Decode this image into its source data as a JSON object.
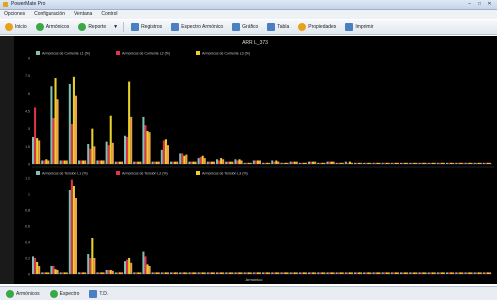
{
  "window": {
    "title": "PowerMate Pro"
  },
  "menu": [
    "Opciones",
    "Configuración",
    "Ventana",
    "Control"
  ],
  "toolbar": {
    "items": [
      {
        "label": "Inicio",
        "icon": "home-icon",
        "color": "#e8a21a"
      },
      {
        "label": "Armónicos",
        "icon": "harmonics-icon",
        "color": "#3aa845"
      },
      {
        "label": "Reporte",
        "icon": "report-icon",
        "color": "#3aa845"
      },
      {
        "label": "Registros",
        "icon": "records-icon",
        "color": "#4a7fc1"
      },
      {
        "label": "Espectro Armónico",
        "icon": "spectrum-icon",
        "color": "#4a7fc1"
      },
      {
        "label": "Gráfico",
        "icon": "chart-icon",
        "color": "#4a7fc1"
      },
      {
        "label": "Tabla",
        "icon": "table-icon",
        "color": "#4a7fc1"
      },
      {
        "label": "Propiedades",
        "icon": "properties-icon",
        "color": "#e8a21a"
      },
      {
        "label": "Imprimir",
        "icon": "printer-icon",
        "color": "#4a7fc1"
      }
    ]
  },
  "status": {
    "items": [
      {
        "label": "Armónicos",
        "color": "#3aa845"
      },
      {
        "label": "Espectro",
        "color": "#3aa845"
      },
      {
        "label": "T.D.",
        "color": "#4a7fc1"
      }
    ]
  },
  "colors": {
    "teal": "#7fbfb5",
    "red": "#e0324a",
    "yellow": "#e8d22a",
    "orange": "#f0a14a",
    "plot_bg": "#000000"
  },
  "chart_data": [
    {
      "type": "bar",
      "title": "ARR  L_373",
      "subtitle": "",
      "ylim": [
        0,
        9
      ],
      "legend_position": "top-left",
      "series": [
        {
          "name": "Armónicos de Corriente L1 (%)",
          "color": "#7fbfb5",
          "values": [
            2.3,
            0.3,
            6.6,
            0.3,
            6.8,
            0.3,
            1.7,
            0.3,
            1.9,
            0.2,
            2.4,
            0.2,
            4.0,
            0.2,
            1.2,
            0.2,
            0.9,
            0.2,
            0.5,
            0.2,
            0.4,
            0.2,
            0.4,
            0.1,
            0.3,
            0.1,
            0.3,
            0.1,
            0.2,
            0.1,
            0.2,
            0.1,
            0.2,
            0.1,
            0.2,
            0.1,
            0.1,
            0.1,
            0.1,
            0.1,
            0.1,
            0.1,
            0.1,
            0.1,
            0.1,
            0.1,
            0.1,
            0.1,
            0.1,
            0.1
          ]
        },
        {
          "name": "Armónicos de Corriente L2 (%)",
          "color": "#e0324a",
          "values": [
            4.8,
            0.3,
            3.9,
            0.3,
            3.4,
            0.3,
            1.3,
            0.3,
            1.6,
            0.2,
            2.3,
            0.2,
            3.3,
            0.2,
            2.0,
            0.2,
            0.9,
            0.2,
            0.6,
            0.2,
            0.3,
            0.2,
            0.3,
            0.1,
            0.3,
            0.1,
            0.2,
            0.1,
            0.2,
            0.1,
            0.2,
            0.1,
            0.2,
            0.1,
            0.1,
            0.1,
            0.1,
            0.1,
            0.1,
            0.1,
            0.1,
            0.1,
            0.1,
            0.1,
            0.1,
            0.1,
            0.1,
            0.1,
            0.1,
            0.1
          ]
        },
        {
          "name": "Armónicos de Corriente L3 (%)",
          "color": "#e8d22a",
          "values": [
            2.2,
            0.4,
            7.3,
            0.3,
            7.4,
            0.3,
            3.0,
            0.3,
            4.1,
            0.2,
            7.0,
            0.2,
            2.8,
            0.2,
            2.1,
            0.2,
            0.7,
            0.2,
            0.7,
            0.2,
            0.5,
            0.2,
            0.4,
            0.1,
            0.3,
            0.1,
            0.3,
            0.1,
            0.2,
            0.1,
            0.2,
            0.1,
            0.2,
            0.1,
            0.2,
            0.1,
            0.1,
            0.1,
            0.1,
            0.1,
            0.1,
            0.1,
            0.1,
            0.1,
            0.1,
            0.1,
            0.1,
            0.1,
            0.1,
            0.1
          ]
        },
        {
          "name": "",
          "color": "#f0a14a",
          "values": [
            2.0,
            0.3,
            5.5,
            0.3,
            5.8,
            0.3,
            1.5,
            0.3,
            1.8,
            0.2,
            4.0,
            0.2,
            2.7,
            0.2,
            1.6,
            0.2,
            0.8,
            0.2,
            0.5,
            0.2,
            0.4,
            0.2,
            0.3,
            0.1,
            0.3,
            0.1,
            0.2,
            0.1,
            0.2,
            0.1,
            0.2,
            0.1,
            0.2,
            0.1,
            0.1,
            0.1,
            0.1,
            0.1,
            0.1,
            0.1,
            0.1,
            0.1,
            0.1,
            0.1,
            0.1,
            0.1,
            0.1,
            0.1,
            0.1,
            0.1
          ]
        }
      ]
    },
    {
      "type": "bar",
      "ylim": [
        0,
        1.2
      ],
      "legend_position": "top-left",
      "xlabel": "Armónico",
      "series": [
        {
          "name": "Armónicos de Tensión L1 (%)",
          "color": "#7fbfb5",
          "values": [
            0.22,
            0.02,
            0.1,
            0.02,
            1.05,
            0.02,
            0.25,
            0.02,
            0.05,
            0.02,
            0.16,
            0.02,
            0.28,
            0.02,
            0.02,
            0.02,
            0.02,
            0.02,
            0.02,
            0.02,
            0.02,
            0.02,
            0.02,
            0.02,
            0.02,
            0.02,
            0.02,
            0.02,
            0.02,
            0.02,
            0.02,
            0.02,
            0.02,
            0.02,
            0.02,
            0.02,
            0.02,
            0.02,
            0.02,
            0.02,
            0.02,
            0.02,
            0.02,
            0.02,
            0.02,
            0.02,
            0.02,
            0.02,
            0.02,
            0.02
          ]
        },
        {
          "name": "Armónicos de Tensión L2 (%)",
          "color": "#e0324a",
          "values": [
            0.2,
            0.02,
            0.1,
            0.02,
            1.18,
            0.02,
            0.2,
            0.02,
            0.05,
            0.02,
            0.18,
            0.02,
            0.22,
            0.02,
            0.02,
            0.02,
            0.02,
            0.02,
            0.02,
            0.02,
            0.02,
            0.02,
            0.02,
            0.02,
            0.02,
            0.02,
            0.02,
            0.02,
            0.02,
            0.02,
            0.02,
            0.02,
            0.02,
            0.02,
            0.02,
            0.02,
            0.02,
            0.02,
            0.02,
            0.02,
            0.02,
            0.02,
            0.02,
            0.02,
            0.02,
            0.02,
            0.02,
            0.02,
            0.02,
            0.02
          ]
        },
        {
          "name": "Armónicos de Tensión L3 (%)",
          "color": "#e8d22a",
          "values": [
            0.15,
            0.02,
            0.06,
            0.02,
            1.1,
            0.02,
            0.45,
            0.02,
            0.05,
            0.02,
            0.2,
            0.02,
            0.12,
            0.02,
            0.02,
            0.02,
            0.02,
            0.02,
            0.02,
            0.02,
            0.02,
            0.02,
            0.02,
            0.02,
            0.02,
            0.02,
            0.02,
            0.02,
            0.02,
            0.02,
            0.02,
            0.02,
            0.02,
            0.02,
            0.02,
            0.02,
            0.02,
            0.02,
            0.02,
            0.02,
            0.02,
            0.02,
            0.02,
            0.02,
            0.02,
            0.02,
            0.02,
            0.02,
            0.02,
            0.02
          ]
        },
        {
          "name": "",
          "color": "#f0a14a",
          "values": [
            0.1,
            0.02,
            0.05,
            0.02,
            0.95,
            0.02,
            0.2,
            0.02,
            0.04,
            0.02,
            0.14,
            0.02,
            0.1,
            0.02,
            0.02,
            0.02,
            0.02,
            0.02,
            0.02,
            0.02,
            0.02,
            0.02,
            0.02,
            0.02,
            0.02,
            0.02,
            0.02,
            0.02,
            0.02,
            0.02,
            0.02,
            0.02,
            0.02,
            0.02,
            0.02,
            0.02,
            0.02,
            0.02,
            0.02,
            0.02,
            0.02,
            0.02,
            0.02,
            0.02,
            0.02,
            0.02,
            0.02,
            0.02,
            0.02,
            0.02
          ]
        }
      ]
    }
  ]
}
